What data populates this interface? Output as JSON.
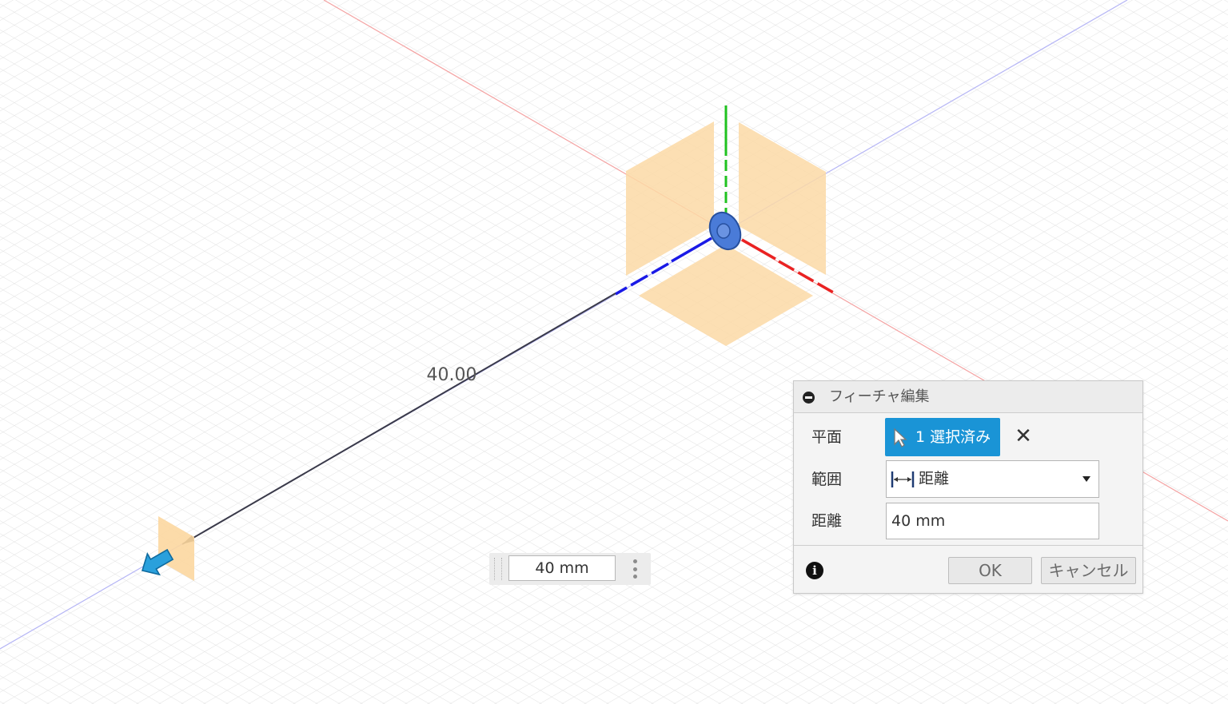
{
  "viewport": {
    "dimension_value": "40.00",
    "colors": {
      "grid": "#dedede",
      "x_axis": "#f3a3a3",
      "y_axis": "#20c420",
      "z_axis": "#b3b3f5",
      "plane_fill": "#fcd7a0",
      "manipulator_arrow": "#1f95d3"
    }
  },
  "floating_input": {
    "value": "40 mm"
  },
  "dialog": {
    "title": "フィーチャ編集",
    "rows": {
      "plane_label": "平面",
      "plane_selection": "1 選択済み",
      "extent_label": "範囲",
      "extent_value": "距離",
      "distance_label": "距離",
      "distance_value": "40 mm"
    },
    "footer": {
      "ok_label": "OK",
      "cancel_label": "キャンセル"
    },
    "accent_color": "#1a94d6"
  }
}
